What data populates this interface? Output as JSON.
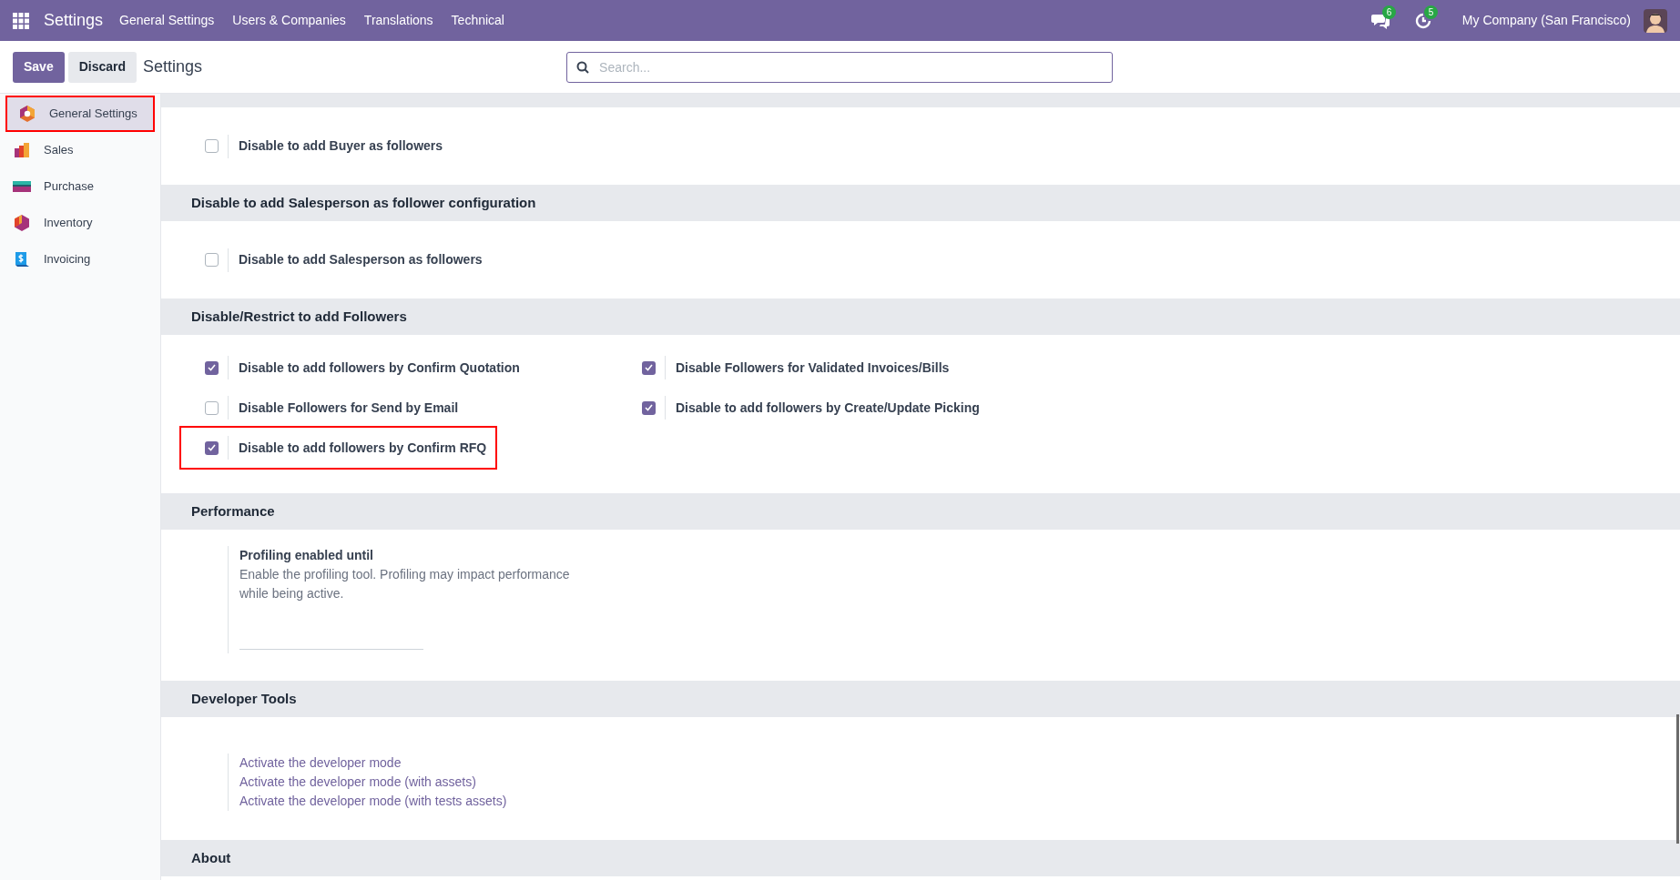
{
  "topbar": {
    "app_name": "Settings",
    "menu": [
      "General Settings",
      "Users & Companies",
      "Translations",
      "Technical"
    ],
    "messages_count": "6",
    "activities_count": "5",
    "company": "My Company (San Francisco)"
  },
  "control_panel": {
    "buttons": [
      {
        "label": "Save",
        "kind": "primary"
      },
      {
        "label": "Discard",
        "kind": "secondary"
      }
    ],
    "title": "Settings",
    "search": {
      "placeholder": "Search..."
    }
  },
  "sidebar": {
    "items": [
      {
        "label": "General Settings",
        "selected": true,
        "highlighted": true
      },
      {
        "label": "Sales",
        "selected": false,
        "highlighted": false
      },
      {
        "label": "Purchase",
        "selected": false,
        "highlighted": false
      },
      {
        "label": "Inventory",
        "selected": false,
        "highlighted": false
      },
      {
        "label": "Invoicing",
        "selected": false,
        "highlighted": false
      }
    ]
  },
  "sections": [
    {
      "kind": "checkboxes",
      "settings": [
        {
          "label": "Disable to add Buyer as followers",
          "checked": false,
          "highlighted": false
        }
      ]
    },
    {
      "kind": "checkboxes",
      "title": "Disable to add Salesperson as follower configuration",
      "settings": [
        {
          "label": "Disable to add Salesperson as followers",
          "checked": false,
          "highlighted": false
        }
      ]
    },
    {
      "kind": "checkboxes",
      "title": "Disable/Restrict to add Followers",
      "settings": [
        {
          "label": "Disable to add followers by Confirm Quotation",
          "checked": true,
          "highlighted": false
        },
        {
          "label": "Disable Followers for Validated Invoices/Bills",
          "checked": true,
          "highlighted": false
        },
        {
          "label": "Disable Followers for Send by Email",
          "checked": false,
          "highlighted": false
        },
        {
          "label": "Disable to add followers by Create/Update Picking",
          "checked": true,
          "highlighted": false
        },
        {
          "label": "Disable to add followers by Confirm RFQ",
          "checked": true,
          "highlighted": true
        }
      ]
    },
    {
      "kind": "field",
      "title": "Performance",
      "setting": {
        "label": "Profiling enabled until",
        "help": "Enable the profiling tool. Profiling may impact performance while being active."
      }
    },
    {
      "kind": "links",
      "title": "Developer Tools",
      "links": [
        "Activate the developer mode",
        "Activate the developer mode (with assets)",
        "Activate the developer mode (with tests assets)"
      ]
    },
    {
      "kind": "heading",
      "title": "About"
    }
  ]
}
